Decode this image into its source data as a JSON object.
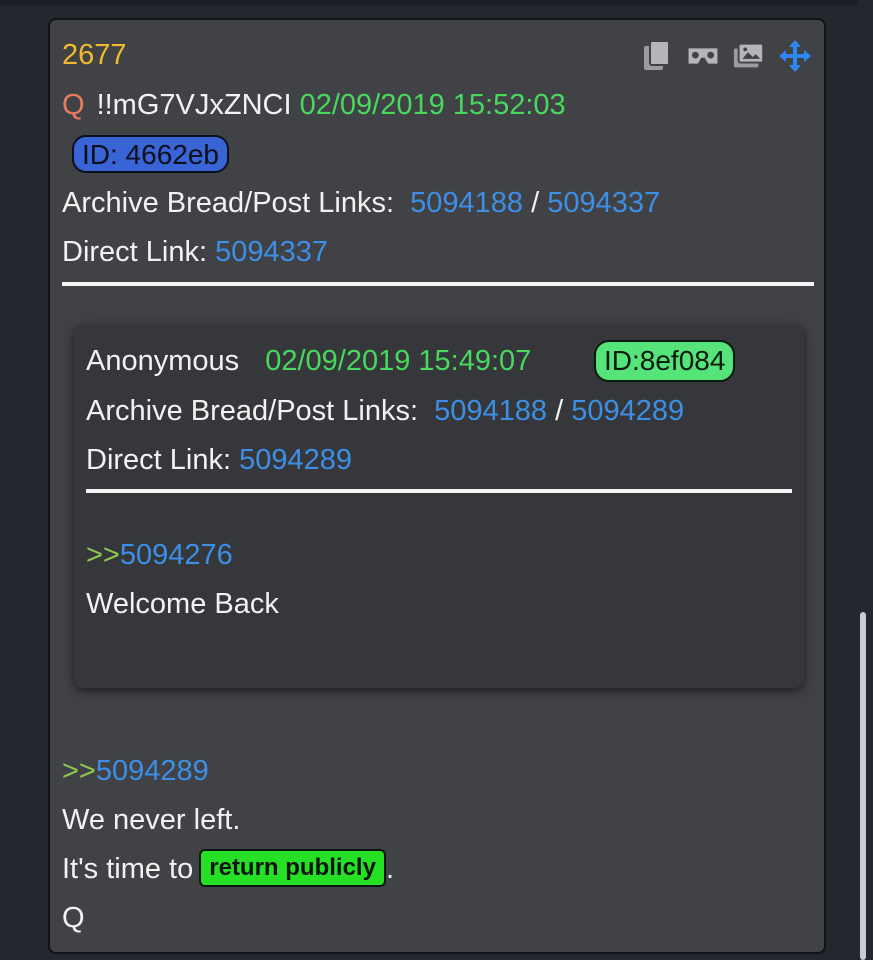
{
  "post": {
    "number": "2677",
    "author": "Q",
    "tripcode": "!!mG7VJxZNCI",
    "timestamp": "02/09/2019 15:52:03",
    "id_label": "ID: 4662eb",
    "archive_label": "Archive Bread/Post Links:",
    "archive_bread_link": "5094188",
    "archive_sep": "/",
    "archive_post_link": "5094337",
    "direct_label": "Direct Link:",
    "direct_link": "5094337",
    "reply_arrow": ">>",
    "reply_to": "5094289",
    "body_line_1": "We never left.",
    "body_line_2_prefix": "It's time to",
    "body_highlight": "return publicly",
    "body_line_2_suffix": ".",
    "signature": "Q"
  },
  "quoted": {
    "author": "Anonymous",
    "timestamp": "02/09/2019 15:49:07",
    "id_label": "ID:8ef084",
    "archive_label": "Archive Bread/Post Links:",
    "archive_bread_link": "5094188",
    "archive_sep": "/",
    "archive_post_link": "5094289",
    "direct_label": "Direct Link:",
    "direct_link": "5094289",
    "reply_arrow": ">>",
    "reply_to": "5094276",
    "body": "Welcome Back"
  },
  "toolbar": {
    "icons": [
      "copy-icon",
      "vr-viewer-icon",
      "image-gallery-icon",
      "move-icon"
    ]
  },
  "colors": {
    "post_number": "#f0b92e",
    "author_q": "#e87b60",
    "timestamp": "#47d85d",
    "link": "#3d8fe6",
    "id_badge_main": "#3964d6",
    "id_badge_quoted": "#56e47a",
    "highlight": "#25e025",
    "quote_arrow": "#8ec84e"
  }
}
